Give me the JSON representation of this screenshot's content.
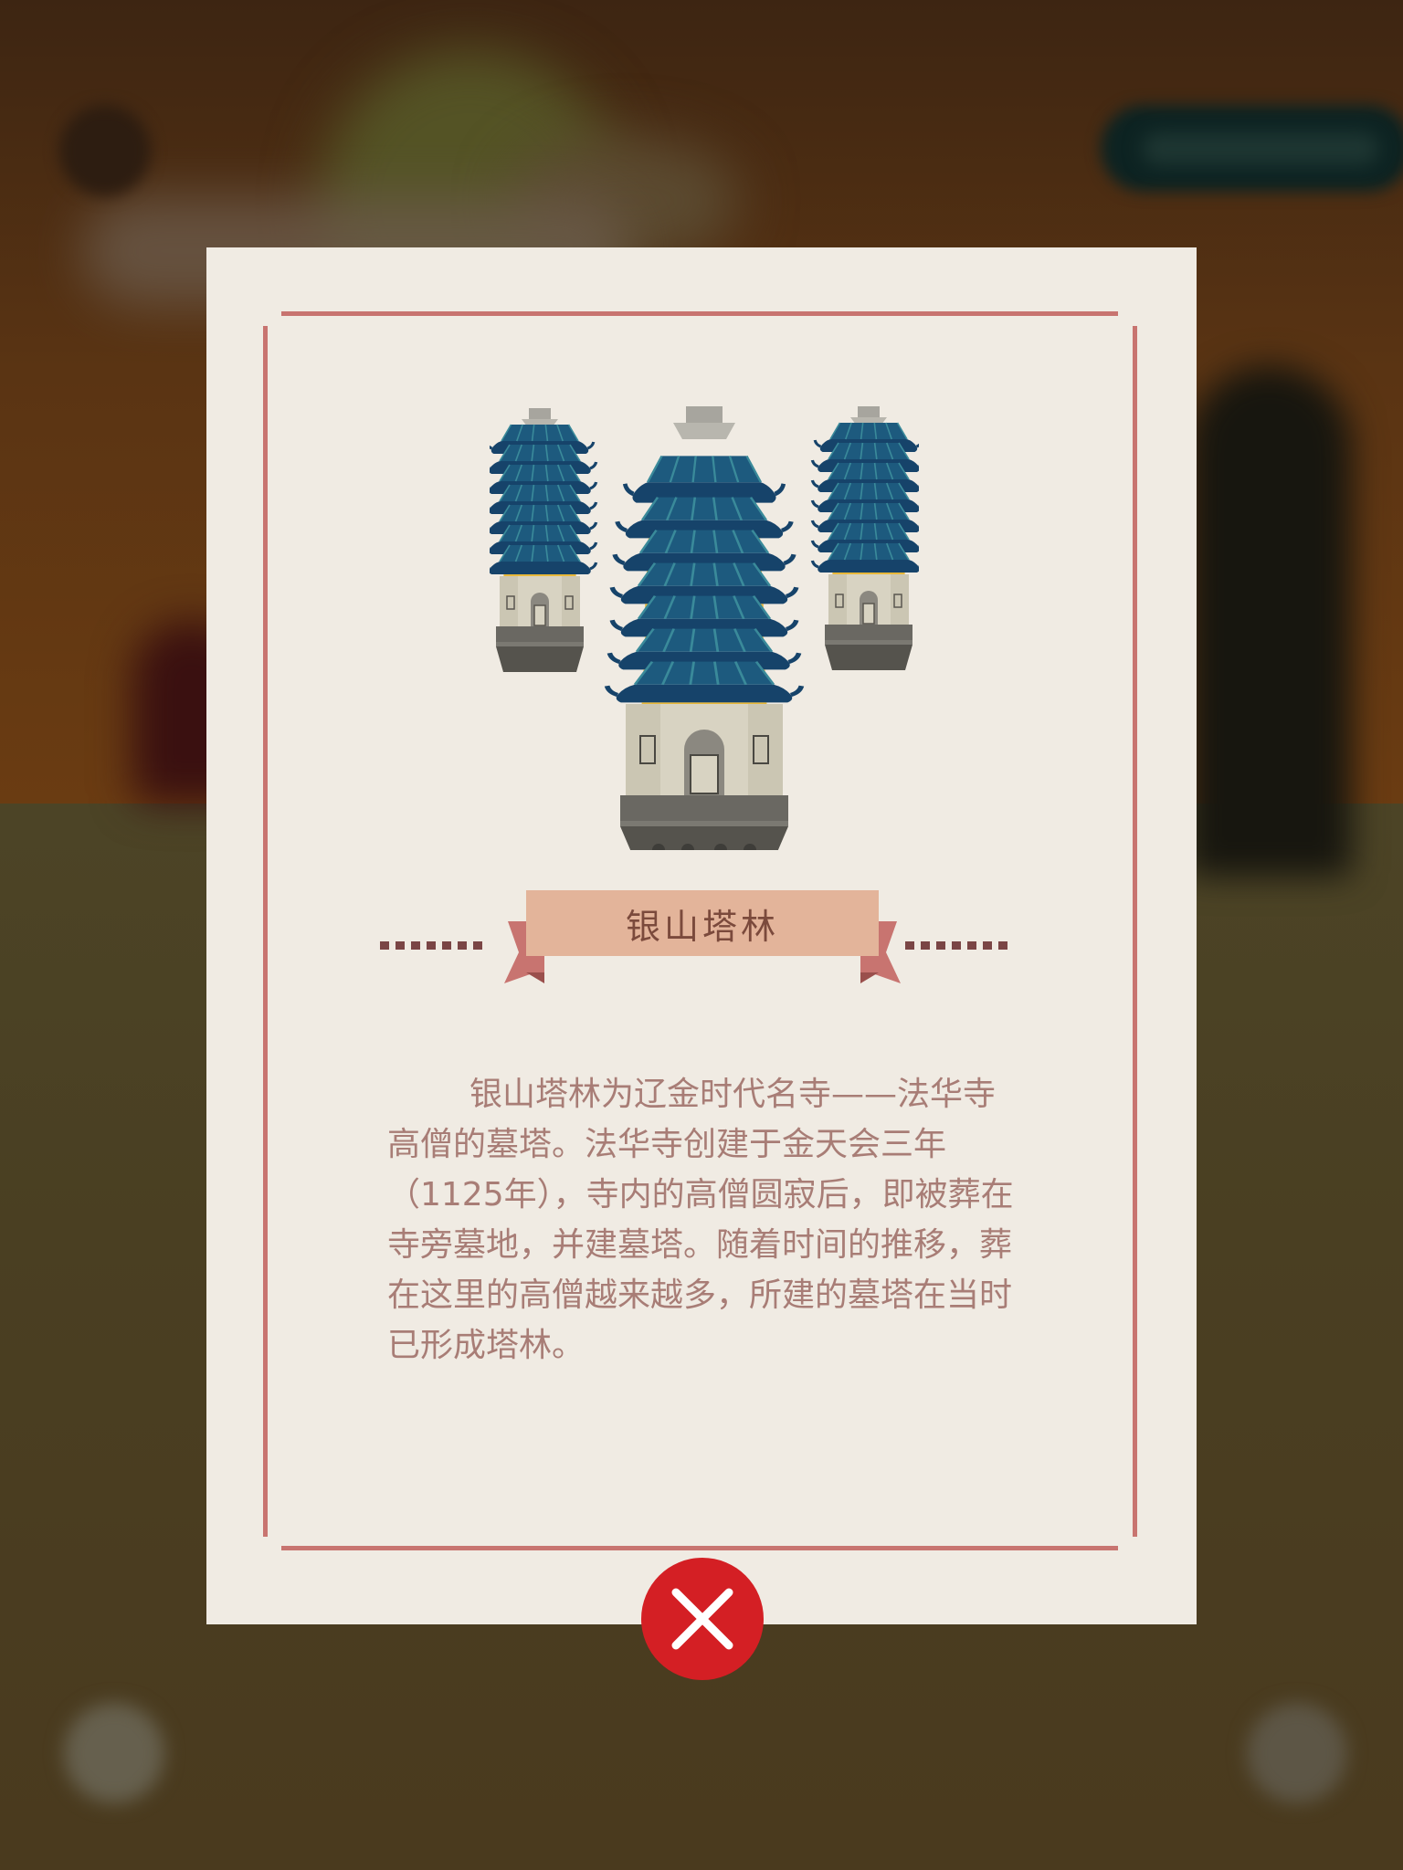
{
  "modal": {
    "title": "银山塔林",
    "description": "银山塔林为辽金时代名寺——法华寺高僧的墓塔。法华寺创建于金天会三年（1125年），寺内的高僧圆寂后，即被葬在寺旁墓地，并建墓塔。随着时间的推移，葬在这里的高僧越来越多，所建的墓塔在当时已形成塔林。",
    "illustration_icon": "pagoda-group-icon",
    "close_icon": "close-icon"
  },
  "colors": {
    "card_background": "#f0ebe3",
    "frame_line": "#c87470",
    "ribbon": "#e3b49a",
    "title_text": "#7b4a3c",
    "body_text": "#a87d76",
    "close_button": "#d41f24",
    "pagoda_roof": "#16436a",
    "pagoda_accent": "#e8b83a"
  }
}
